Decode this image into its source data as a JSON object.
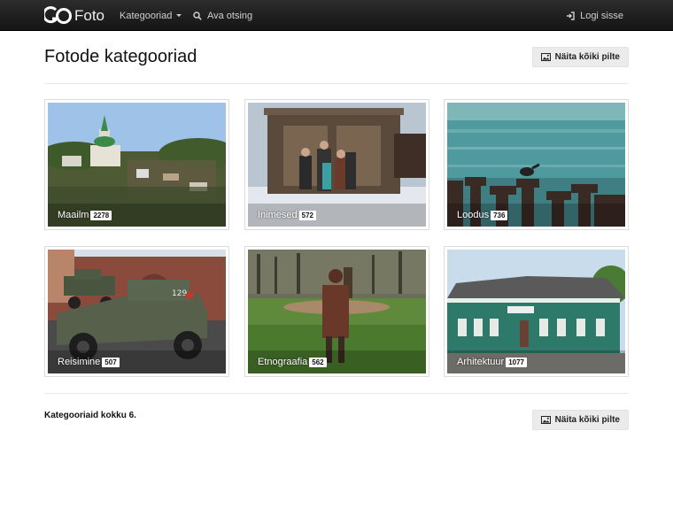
{
  "navbar": {
    "brand": "Foto",
    "categories_label": "Kategooriad",
    "search_label": "Ava otsing",
    "login_label": "Logi sisse"
  },
  "page": {
    "title": "Fotode kategooriad",
    "show_all_label": "Näita kõiki pilte"
  },
  "categories": [
    {
      "label": "Maailm",
      "count": "2278"
    },
    {
      "label": "Inimesed",
      "count": "572"
    },
    {
      "label": "Loodus",
      "count": "736"
    },
    {
      "label": "Reisimine",
      "count": "507"
    },
    {
      "label": "Etnograafia",
      "count": "562"
    },
    {
      "label": "Arhitektuur",
      "count": "1077"
    }
  ],
  "footer": {
    "total_prefix": "Kategooriaid kokku",
    "total_count": "6",
    "total_suffix": ".",
    "show_all_label": "Näita kõiki pilte"
  },
  "colors": {
    "navbar": "#1f1f1f",
    "button_bg": "#ebebeb"
  }
}
